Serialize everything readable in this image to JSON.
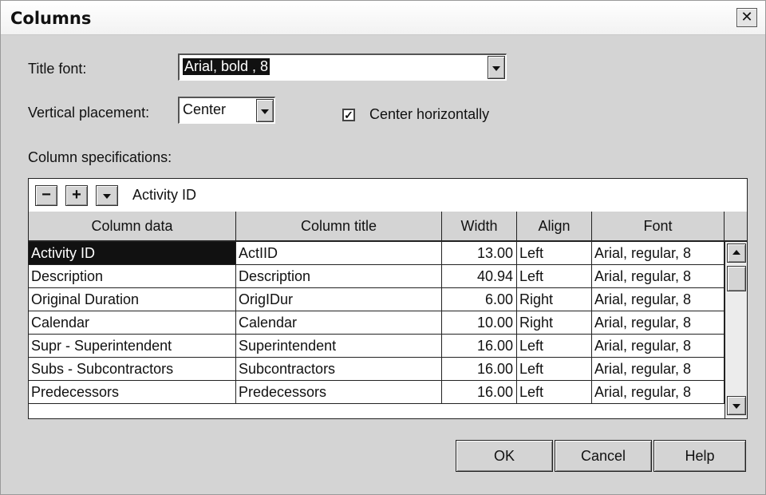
{
  "dialog": {
    "title": "Columns",
    "close_glyph": "✕"
  },
  "title_font": {
    "label": "Title font:",
    "value": "Arial, bold , 8"
  },
  "vertical_placement": {
    "label": "Vertical placement:",
    "value": "Center"
  },
  "center_horizontally": {
    "label": "Center horizontally",
    "checked": true
  },
  "column_specs": {
    "label": "Column specifications:",
    "toolbar": {
      "remove_label": "−",
      "add_label": "+",
      "current": "Activity ID"
    },
    "headers": [
      "Column data",
      "Column title",
      "Width",
      "Align",
      "Font"
    ],
    "rows": [
      [
        "Activity ID",
        "ActIID",
        "13.00",
        "Left",
        "Arial, regular, 8"
      ],
      [
        "Description",
        "Description",
        "40.94",
        "Left",
        "Arial, regular, 8"
      ],
      [
        "Original Duration",
        "OrigIDur",
        "6.00",
        "Right",
        "Arial, regular, 8"
      ],
      [
        "Calendar",
        "Calendar",
        "10.00",
        "Right",
        "Arial, regular, 8"
      ],
      [
        "Supr - Superintendent",
        "Superintendent",
        "16.00",
        "Left",
        "Arial, regular, 8"
      ],
      [
        "Subs - Subcontractors",
        "Subcontractors",
        "16.00",
        "Left",
        "Arial, regular, 8"
      ],
      [
        "Predecessors",
        "Predecessors",
        "16.00",
        "Left",
        "Arial, regular, 8"
      ]
    ],
    "selected_row": 0
  },
  "buttons": {
    "ok": "OK",
    "cancel": "Cancel",
    "help": "Help"
  },
  "colors": {
    "dialog_bg": "#d4d4d4",
    "selection_bg": "#111111",
    "field_bg": "#ffffff"
  }
}
